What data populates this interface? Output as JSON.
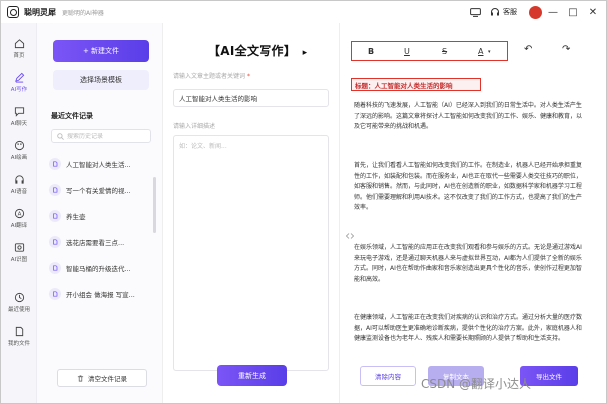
{
  "app": {
    "name": "聪明灵犀",
    "slogan": "更聪明的AI神器"
  },
  "titlebar": {
    "service_label": "客服",
    "minimize": "—",
    "maximize": "□",
    "close": "✕"
  },
  "nav": [
    {
      "label": "首页",
      "icon": "home-icon"
    },
    {
      "label": "AI写作",
      "icon": "pen-icon",
      "active": true
    },
    {
      "label": "AI聊天",
      "icon": "chat-icon"
    },
    {
      "label": "AI绘画",
      "icon": "brush-icon"
    },
    {
      "label": "AI语音",
      "icon": "headphone-icon"
    },
    {
      "label": "AI翻译",
      "icon": "translate-icon"
    },
    {
      "label": "AI识图",
      "icon": "image-icon"
    },
    {
      "label": "最近使用",
      "icon": "clock-icon"
    },
    {
      "label": "我的文件",
      "icon": "file-icon"
    }
  ],
  "files": {
    "new_file_label": "+ 新建文件",
    "scene_template_label": "选择场景模板",
    "recent_title": "最近文件记录",
    "search_placeholder": "搜索历史记录",
    "items": [
      "人工智能对人类生活...",
      "写一个有关爱情的视...",
      "养生壶",
      "选花店需要看三点...",
      "智能马桶的升级迭代...",
      "开小组会 做海报 写宣..."
    ],
    "clear_label": "清空文件记录"
  },
  "middle": {
    "title": "【AI全文写作】",
    "title_arrow": "▸",
    "topic_label": "请输入文章主题或者关键词",
    "topic_required": "*",
    "topic_value": "人工智能对人类生活的影响",
    "detail_label": "请输入详细描述",
    "detail_placeholder": "如：论文、新闻...",
    "regenerate_label": "重新生成"
  },
  "editor": {
    "toolbar": {
      "bold": "B",
      "underline": "U",
      "strike": "S",
      "color": "A",
      "undo": "↶",
      "redo": "↷"
    },
    "heading": "标题：人工智能对人类生活的影响",
    "paragraphs": [
      "随着科技的飞速发展，人工智能（AI）已经深入到我们的日常生活中。对人类生活产生了深远的影响。这篇文章将探讨人工智能如何改变我们的工作、娱乐、健康和教育，以及它可能带来的挑战和机遇。",
      "首先，让我们看看人工智能如何改变我们的工作。在制造业，机器人已经开始承担重复性的工作，如装配和包装。而在服务业，AI也正在取代一些需要人类交往技巧的职位，如客服和销售。然而，与此同时，AI也在创造新的职业，如数据科学家和机器学习工程师。他们需要理解和利用AI技术。这不仅改变了我们的工作方式，也提高了我们的生产效率。",
      "在娱乐领域，人工智能的应用正在改变我们观看和参与娱乐的方式。无论是通过游戏AI来玩电子游戏，还是通过聊天机器人来与虚拟世界互动，AI都为人们提供了全新的娱乐方式。同时，AI也在帮助作曲家和音乐家创造出更具个性化的音乐，使创作过程更加智能和高效。",
      "在健康领域，人工智能正在改变我们对疾病的认识和治疗方式。通过分析大量的医疗数据，AI可以帮助医生更准确地诊断疾病，提供个性化的治疗方案。此外，家庭机器人和健康监测设备也为老年人、残疾人和需要长期照顾的人提供了帮助和生活支持。"
    ],
    "clear_label": "清除内容",
    "copy_label": "复制文本",
    "export_label": "导出文件"
  },
  "watermark": "CSDN @翻译小达人",
  "colors": {
    "accent": "#6d4ef5",
    "highlight": "#e0332a",
    "heading_text": "#c62f2f"
  }
}
